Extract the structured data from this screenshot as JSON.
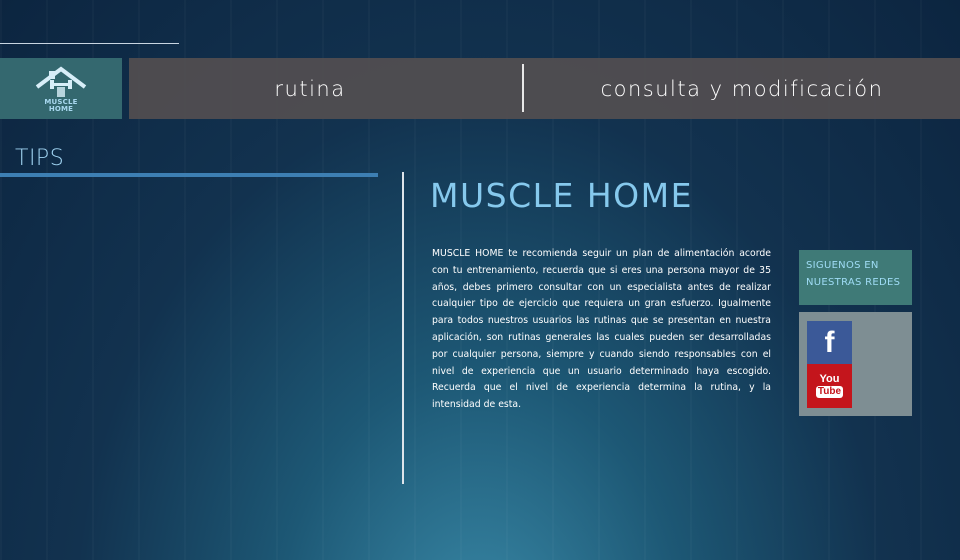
{
  "header": {
    "logo_line1": "MUSCLE",
    "logo_line2": "HOME",
    "nav": [
      {
        "label": "rutina"
      },
      {
        "label": "consulta y modificación"
      }
    ]
  },
  "sidebar": {
    "title": "TIPS"
  },
  "main": {
    "title": "MUSCLE HOME",
    "body": "MUSCLE HOME te recomienda seguir un plan de alimentación acorde con tu entrenamiento, recuerda que si eres una persona mayor de 35 años, debes primero consultar con un especialista antes de realizar cualquier tipo de ejercicio que requiera un gran esfuerzo. Igualmente para todos nuestros usuarios las rutinas que se presentan en nuestra aplicación, son rutinas generales las cuales pueden ser desarrolladas por cualquier persona, siempre y cuando siendo responsables con el nivel de experiencia que un usuario determinado haya escogido. Recuerda que el nivel de experiencia determina la rutina, y la intensidad de esta."
  },
  "social": {
    "header_line1": "SIGUENOS EN",
    "header_line2": "NUESTRAS REDES",
    "facebook_icon": "f",
    "youtube_line1": "You",
    "youtube_line2": "Tube"
  },
  "colors": {
    "accent": "#86c9ed",
    "nav_bg": "#524e50",
    "logo_bg": "#34686f",
    "facebook": "#3b5998",
    "youtube": "#c4151c"
  }
}
